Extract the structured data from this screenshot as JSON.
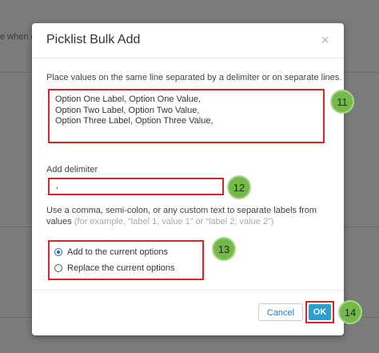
{
  "background": {
    "partial_text": "e when c"
  },
  "modal": {
    "title": "Picklist Bulk Add",
    "close_glyph": "×",
    "intro_text": "Place values on the same line separated by a delimiter or on separate lines.",
    "values_lines": [
      "Option One Label, Option One Value,",
      "Option Two Label, Option Two Value,",
      "Option Three Label, Option Three Value,"
    ],
    "delimiter_label": "Add delimiter",
    "delimiter_value": ",",
    "help_text": "Use a comma, semi-colon, or any custom text to separate labels from values",
    "help_example": "(for example, “label 1, value 1” or “label 2; value 2”)",
    "radio_options": [
      {
        "label": "Add to the current options",
        "checked": true
      },
      {
        "label": "Replace the current options",
        "checked": false
      }
    ],
    "cancel_label": "Cancel",
    "ok_label": "OK"
  },
  "callouts": [
    "11",
    "12",
    "13",
    "14"
  ],
  "colors": {
    "highlight_border": "#d9262a",
    "callout_fill": "#74b94a",
    "primary_button": "#2c9fd0",
    "link_blue": "#2d7ab5"
  },
  "icons": {
    "close": "close-icon",
    "radio_selected": "radio-selected-icon",
    "radio_unselected": "radio-unselected-icon"
  }
}
